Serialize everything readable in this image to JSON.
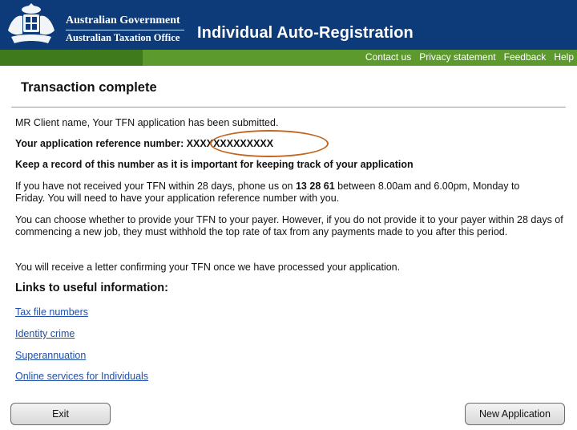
{
  "header": {
    "gov_line1": "Australian Government",
    "gov_line2": "Australian Taxation Office",
    "app_title": "Individual Auto-Registration",
    "colors": {
      "header_bg": "#0d3b7a",
      "nav_bg": "#5d9a2e",
      "nav_dark": "#3f7a1c"
    }
  },
  "nav": {
    "links": [
      "Contact us",
      "Privacy statement",
      "Feedback",
      "Help"
    ]
  },
  "page": {
    "title": "Transaction complete",
    "submitted": "MR Client name, Your TFN application has been submitted.",
    "ref_label": "Your application reference number:",
    "ref_number": "XXXXXXXXXXXXX",
    "keep_record": "Keep a record of this number as it is important for keeping track of your application",
    "phone_pre": "If you have not received your TFN within 28 days, phone us on",
    "phone_number": "13 28 61",
    "phone_post": "between 8.00am and 6.00pm, Monday to Friday. You will need to have your application reference number with you.",
    "payer": "You can choose whether to provide your TFN to your payer. However, if you do not provide it to your payer within 28 days of commencing a new job, they must withhold the top rate of tax from any payments made to you after this period.",
    "letter": "You will receive a letter confirming your TFN once we have processed your application.",
    "links_heading": "Links to useful information:",
    "links": [
      "Tax file numbers",
      "Identity crime",
      "Superannuation",
      "Online services for Individuals"
    ]
  },
  "buttons": {
    "exit": "Exit",
    "new_application": "New Application"
  },
  "annotation_color": "#c2661f"
}
